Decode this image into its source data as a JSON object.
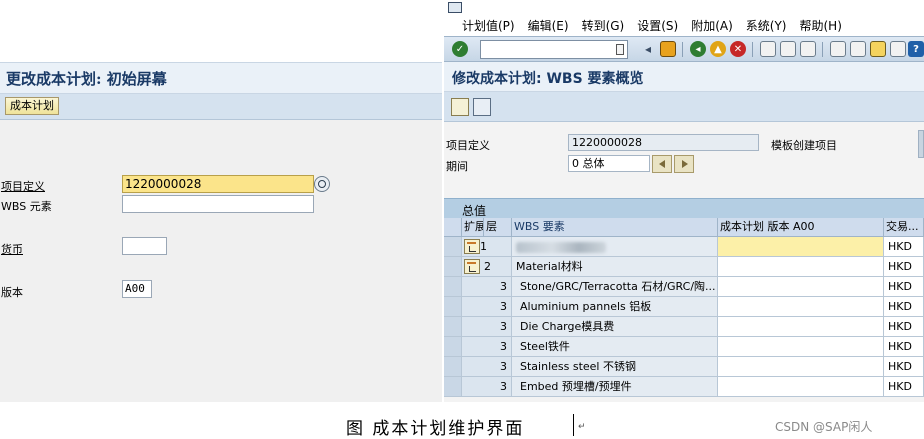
{
  "left": {
    "title": "更改成本计划: 初始屏幕",
    "toolbar_button": "成本计划",
    "fields": {
      "project_def_label": "项目定义",
      "project_def_value": "1220000028",
      "wbs_label": "WBS 元素",
      "wbs_value": "",
      "currency_label": "货币",
      "currency_value": "",
      "version_label": "版本",
      "version_value": "A00"
    }
  },
  "right": {
    "menu": [
      "计划值(P)",
      "编辑(E)",
      "转到(G)",
      "设置(S)",
      "附加(A)",
      "系统(Y)",
      "帮助(H)"
    ],
    "title": "修改成本计划: WBS 要素概览",
    "header": {
      "project_def_label": "项目定义",
      "project_def_value": "1220000028",
      "project_desc": "模板创建项目",
      "period_label": "期间",
      "period_value": "0 总体"
    },
    "table": {
      "title": "总值",
      "columns": [
        "扩展",
        "层",
        "WBS 要素",
        "成本计划 版本 A00",
        "交易..."
      ],
      "rows": [
        {
          "level": "1",
          "wbs": "",
          "value": "",
          "currency": "HKD",
          "expand": true,
          "highlight": true
        },
        {
          "level": "2",
          "wbs": "Material材料",
          "value": "",
          "currency": "HKD",
          "expand": true,
          "highlight": false
        },
        {
          "level": "3",
          "wbs": "Stone/GRC/Terracotta 石材/GRC/陶...",
          "value": "",
          "currency": "HKD",
          "expand": false,
          "highlight": false
        },
        {
          "level": "3",
          "wbs": "Aluminium pannels 铝板",
          "value": "",
          "currency": "HKD",
          "expand": false,
          "highlight": false
        },
        {
          "level": "3",
          "wbs": "Die Charge模具费",
          "value": "",
          "currency": "HKD",
          "expand": false,
          "highlight": false
        },
        {
          "level": "3",
          "wbs": "Steel铁件",
          "value": "",
          "currency": "HKD",
          "expand": false,
          "highlight": false
        },
        {
          "level": "3",
          "wbs": "Stainless steel 不锈钢",
          "value": "",
          "currency": "HKD",
          "expand": false,
          "highlight": false
        },
        {
          "level": "3",
          "wbs": "Embed 预埋槽/预埋件",
          "value": "",
          "currency": "HKD",
          "expand": false,
          "highlight": false
        }
      ]
    }
  },
  "caption": {
    "text": "图  成本计划维护界面",
    "return_mark": "↵",
    "watermark": "CSDN @SAP闲人"
  },
  "icons": {
    "system": "sap-system-icon",
    "enter": "enter-check-icon",
    "save": "save-icon",
    "back": "back-icon",
    "exit": "exit-icon",
    "cancel": "cancel-icon",
    "print": "print-icon",
    "find": "find-icon",
    "find_next": "find-next-icon",
    "new_session": "new-session-icon",
    "shortcut": "shortcut-icon",
    "help": "help-icon"
  },
  "colors": {
    "title_text": "#1a3a66",
    "focus_field": "#fbe48a",
    "table_header": "#cfdced",
    "enter_green": "#2f7d32",
    "cancel_red": "#c62828"
  }
}
